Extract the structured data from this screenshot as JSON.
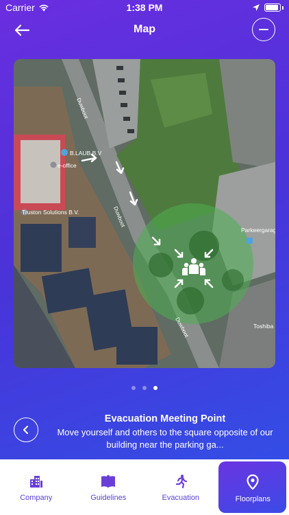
{
  "status_bar": {
    "carrier": "Carrier",
    "time": "1:38 PM"
  },
  "nav": {
    "title": "Map"
  },
  "map": {
    "labels": {
      "street_1": "Duwboot",
      "street_2": "Duwboot",
      "street_3": "Duwboot",
      "poi_1": "B.LAUB B.V",
      "poi_2": "e-office",
      "poi_3": "Truston Solutions B.V.",
      "poi_4": "Parkeergarage",
      "poi_5": "Toshiba"
    },
    "meeting_zone_color": "#4caf50"
  },
  "pager": {
    "total": 3,
    "active_index": 2
  },
  "info": {
    "title": "Evacuation Meeting Point",
    "description": "Move yourself and others to the square opposite of our building near the parking ga..."
  },
  "tabs": [
    {
      "label": "Company",
      "icon": "building-icon"
    },
    {
      "label": "Guidelines",
      "icon": "book-icon"
    },
    {
      "label": "Evacuation",
      "icon": "running-person-icon"
    },
    {
      "label": "Floorplans",
      "icon": "map-pin-icon",
      "active": true
    }
  ],
  "colors": {
    "accent": "#5a3fd8",
    "gradient_start": "#6a2ee0",
    "gradient_end": "#2f52e8"
  }
}
